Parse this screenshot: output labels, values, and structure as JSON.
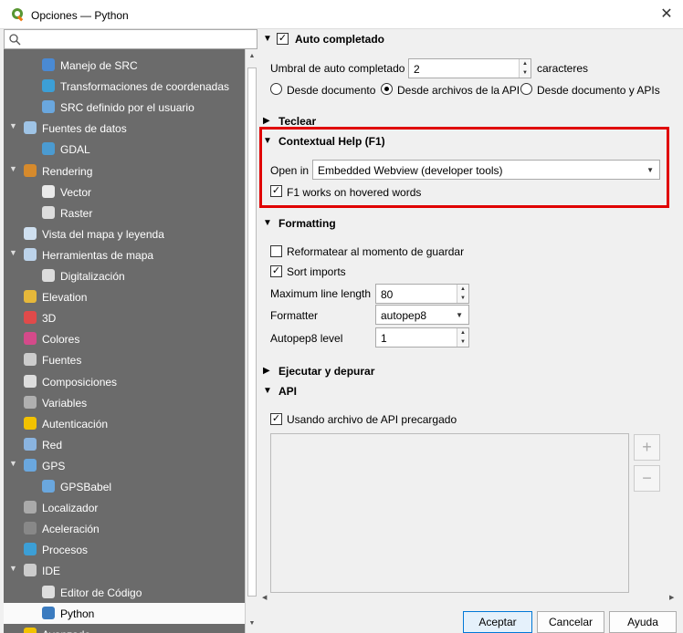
{
  "window": {
    "title": "Opciones — Python",
    "close_glyph": "✕"
  },
  "search": {
    "placeholder": ""
  },
  "tree": [
    {
      "label": "Manejo de SRC",
      "indent": 2,
      "icon": "globe-icon"
    },
    {
      "label": "Transformaciones de coordenadas",
      "indent": 2,
      "icon": "transform-icon"
    },
    {
      "label": "SRC definido por el usuario",
      "indent": 2,
      "icon": "user-crs-icon"
    },
    {
      "label": "Fuentes de datos",
      "indent": 1,
      "icon": "table-icon",
      "expanded": true
    },
    {
      "label": "GDAL",
      "indent": 2,
      "icon": "gdal-icon"
    },
    {
      "label": "Rendering",
      "indent": 1,
      "icon": "brush-icon",
      "expanded": true
    },
    {
      "label": "Vector",
      "indent": 2,
      "icon": "vector-icon"
    },
    {
      "label": "Raster",
      "indent": 2,
      "icon": "raster-icon"
    },
    {
      "label": "Vista del mapa y leyenda",
      "indent": 1,
      "icon": "map-icon"
    },
    {
      "label": "Herramientas de mapa",
      "indent": 1,
      "icon": "map-tools-icon",
      "expanded": true
    },
    {
      "label": "Digitalización",
      "indent": 2,
      "icon": "digitize-icon"
    },
    {
      "label": "Elevation",
      "indent": 1,
      "icon": "elevation-icon"
    },
    {
      "label": "3D",
      "indent": 1,
      "icon": "cube-icon"
    },
    {
      "label": "Colores",
      "indent": 1,
      "icon": "colors-icon"
    },
    {
      "label": "Fuentes",
      "indent": 1,
      "icon": "font-icon"
    },
    {
      "label": "Composiciones",
      "indent": 1,
      "icon": "layout-icon"
    },
    {
      "label": "Variables",
      "indent": 1,
      "icon": "variables-icon"
    },
    {
      "label": "Autenticación",
      "indent": 1,
      "icon": "lock-icon"
    },
    {
      "label": "Red",
      "indent": 1,
      "icon": "network-icon"
    },
    {
      "label": "GPS",
      "indent": 1,
      "icon": "gps-icon",
      "expanded": true
    },
    {
      "label": "GPSBabel",
      "indent": 2,
      "icon": "gpsbabel-icon"
    },
    {
      "label": "Localizador",
      "indent": 1,
      "icon": "search-icon"
    },
    {
      "label": "Aceleración",
      "indent": 1,
      "icon": "acceleration-icon"
    },
    {
      "label": "Procesos",
      "indent": 1,
      "icon": "gear-icon"
    },
    {
      "label": "IDE",
      "indent": 1,
      "icon": "ide-icon",
      "expanded": true
    },
    {
      "label": "Editor de Código",
      "indent": 2,
      "icon": "code-editor-icon"
    },
    {
      "label": "Python",
      "indent": 2,
      "icon": "python-icon",
      "selected": true
    },
    {
      "label": "Avanzado",
      "indent": 1,
      "icon": "warning-icon"
    }
  ],
  "autocomplete": {
    "title": "Auto completado",
    "threshold_label": "Umbral de auto completado",
    "threshold_value": "2",
    "threshold_unit": "caracteres",
    "radio_document": "Desde documento",
    "radio_api": "Desde archivos de la API",
    "radio_both": "Desde documento y APIs"
  },
  "typing": {
    "title": "Teclear"
  },
  "contextual_help": {
    "title": "Contextual Help (F1)",
    "open_in_label": "Open in",
    "open_in_value": "Embedded Webview (developer tools)",
    "f1_label": "F1 works on hovered words"
  },
  "formatting": {
    "title": "Formatting",
    "reformat_label": "Reformatear al momento de guardar",
    "sort_imports_label": "Sort imports",
    "max_line_label": "Maximum line length",
    "max_line_value": "80",
    "formatter_label": "Formatter",
    "formatter_value": "autopep8",
    "autopep_label": "Autopep8 level",
    "autopep_value": "1"
  },
  "run_debug": {
    "title": "Ejecutar y depurar"
  },
  "api": {
    "title": "API",
    "use_prepared_label": "Usando archivo de API precargado",
    "add_glyph": "+",
    "remove_glyph": "−"
  },
  "buttons": {
    "ok": "Aceptar",
    "cancel": "Cancelar",
    "help": "Ayuda"
  },
  "colors": {
    "highlight": "#e00000",
    "tree_bg": "#6b6b6b",
    "accent": "#0078d7"
  }
}
